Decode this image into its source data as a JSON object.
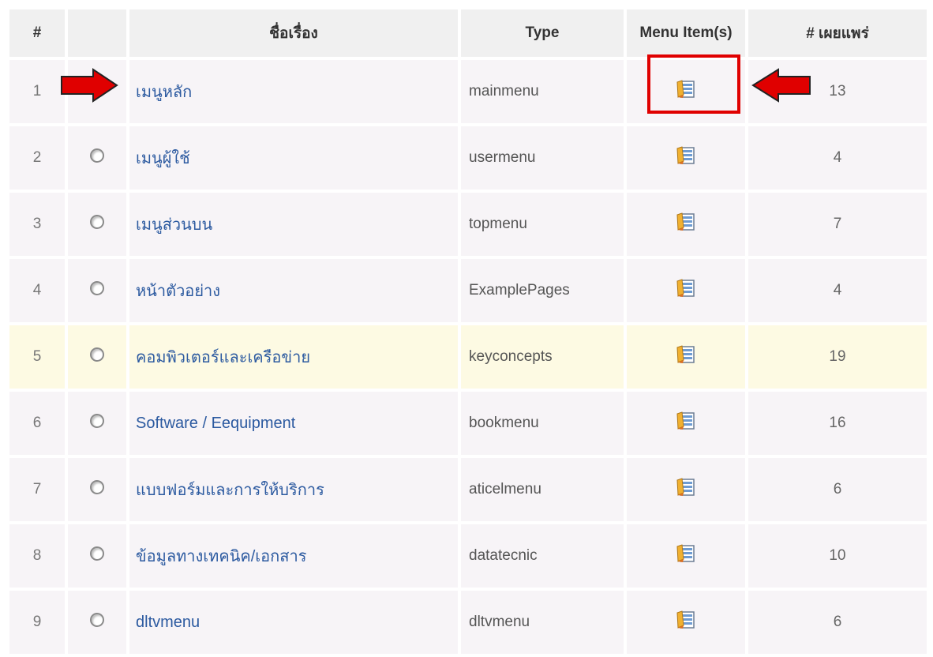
{
  "table": {
    "headers": {
      "num": "#",
      "blank": "",
      "title": "ชื่อเรื่อง",
      "type": "Type",
      "menu_items": "Menu Item(s)",
      "published": "# เผยแพร่"
    },
    "rows": [
      {
        "num": "1",
        "title": "เมนูหลัก",
        "type": "mainmenu",
        "published": "13",
        "radio": false,
        "highlight": false
      },
      {
        "num": "2",
        "title": "เมนูผู้ใช้",
        "type": "usermenu",
        "published": "4",
        "radio": true,
        "highlight": false
      },
      {
        "num": "3",
        "title": "เมนูส่วนบน",
        "type": "topmenu",
        "published": "7",
        "radio": true,
        "highlight": false
      },
      {
        "num": "4",
        "title": "หน้าตัวอย่าง",
        "type": "ExamplePages",
        "published": "4",
        "radio": true,
        "highlight": false
      },
      {
        "num": "5",
        "title": "คอมพิวเตอร์และเครือข่าย",
        "type": "keyconcepts",
        "published": "19",
        "radio": true,
        "highlight": true
      },
      {
        "num": "6",
        "title": "Software / Eequipment",
        "type": "bookmenu",
        "published": "16",
        "radio": true,
        "highlight": false
      },
      {
        "num": "7",
        "title": "แบบฟอร์มและการให้บริการ",
        "type": "aticelmenu",
        "published": "6",
        "radio": true,
        "highlight": false
      },
      {
        "num": "8",
        "title": "ข้อมูลทางเทคนิค/เอกสาร",
        "type": "datatecnic",
        "published": "10",
        "radio": true,
        "highlight": false
      },
      {
        "num": "9",
        "title": "dltvmenu",
        "type": "dltvmenu",
        "published": "6",
        "radio": true,
        "highlight": false
      }
    ]
  },
  "icons": {
    "menu_items": "menu-items-icon",
    "arrow": "red-arrow-icon"
  },
  "colors": {
    "highlight_row": "#fdfae3",
    "annotation_red": "#e00000",
    "link": "#2c5aa0",
    "row_bg": "#f7f4f7"
  }
}
